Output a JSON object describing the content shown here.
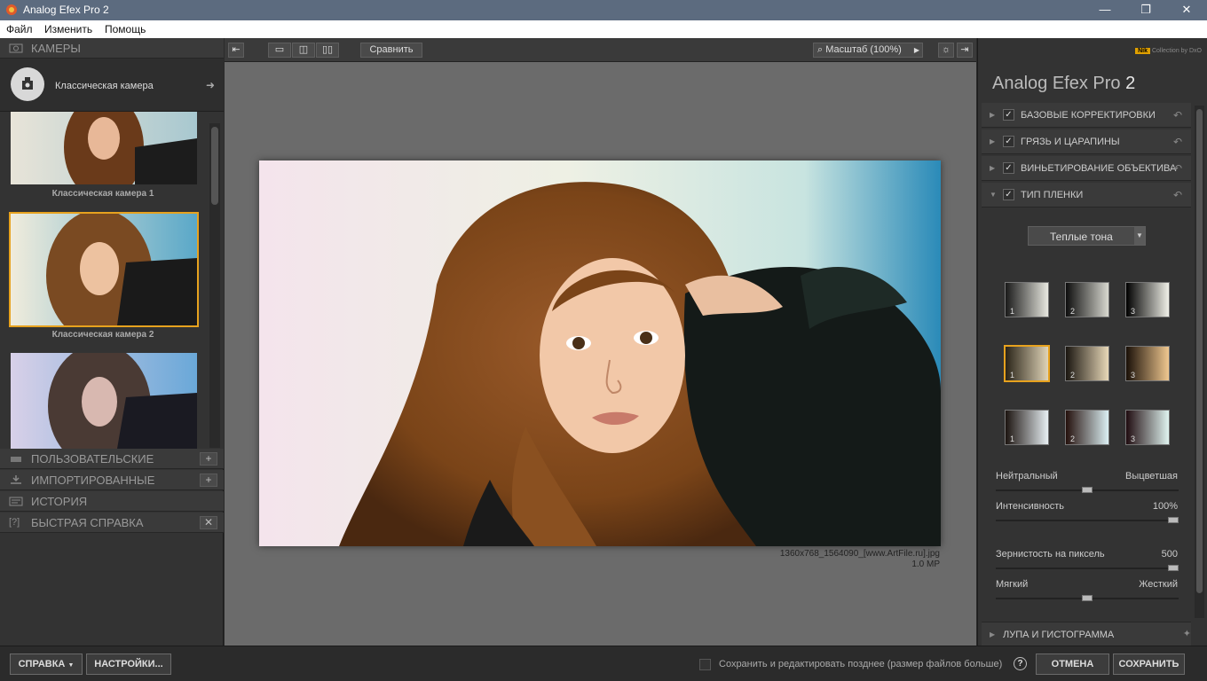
{
  "window": {
    "title": "Analog Efex Pro 2",
    "minimize": "—",
    "maximize": "❐",
    "close": "✕"
  },
  "menu": [
    "Файл",
    "Изменить",
    "Помощь"
  ],
  "left": {
    "cameras_header": "КАМЕРЫ",
    "selected_camera": "Классическая камера",
    "presets": [
      "Классическая камера 1",
      "Классическая камера 2"
    ],
    "sections": [
      "ПОЛЬЗОВАТЕЛЬСКИЕ",
      "ИМПОРТИРОВАННЫЕ",
      "ИСТОРИЯ",
      "БЫСТРАЯ СПРАВКА"
    ],
    "quick_help_icon": "[?]"
  },
  "toolbar": {
    "compare": "Сравнить",
    "zoom": "Масштаб (100%)"
  },
  "image": {
    "filename": "1360x768_1564090_[www.ArtFile.ru].jpg",
    "size": "1.0 MP"
  },
  "right": {
    "brand_small": "Collection by DxO",
    "brand_badge": "Nik",
    "app_name": "Analog Efex Pro",
    "app_version": "2",
    "filters": [
      "БАЗОВЫЕ КОРРЕКТИРОВКИ",
      "ГРЯЗЬ И ЦАРАПИНЫ",
      "ВИНЬЕТИРОВАНИЕ ОБЪЕКТИВА",
      "ТИП ПЛЕНКИ"
    ],
    "film_type": "Теплые тона",
    "swatch_numbers": [
      "1",
      "2",
      "3"
    ],
    "slider1_left": "Нейтральный",
    "slider1_right": "Выцветшая",
    "intensity_label": "Интенсивность",
    "intensity_value": "100%",
    "grain_label": "Зернистость на пиксель",
    "grain_value": "500",
    "slider3_left": "Мягкий",
    "slider3_right": "Жесткий",
    "loupe": "ЛУПА И ГИСТОГРАММА",
    "slider_levels": {
      "tone": 0.5,
      "intensity": 1.0,
      "grain": 1.0,
      "softness": 0.5
    }
  },
  "bottom": {
    "help": "СПРАВКА",
    "settings": "НАСТРОЙКИ...",
    "save_later": "Сохранить и редактировать позднее (размер файлов больше)",
    "cancel": "ОТМЕНА",
    "save": "СОХРАНИТЬ"
  }
}
